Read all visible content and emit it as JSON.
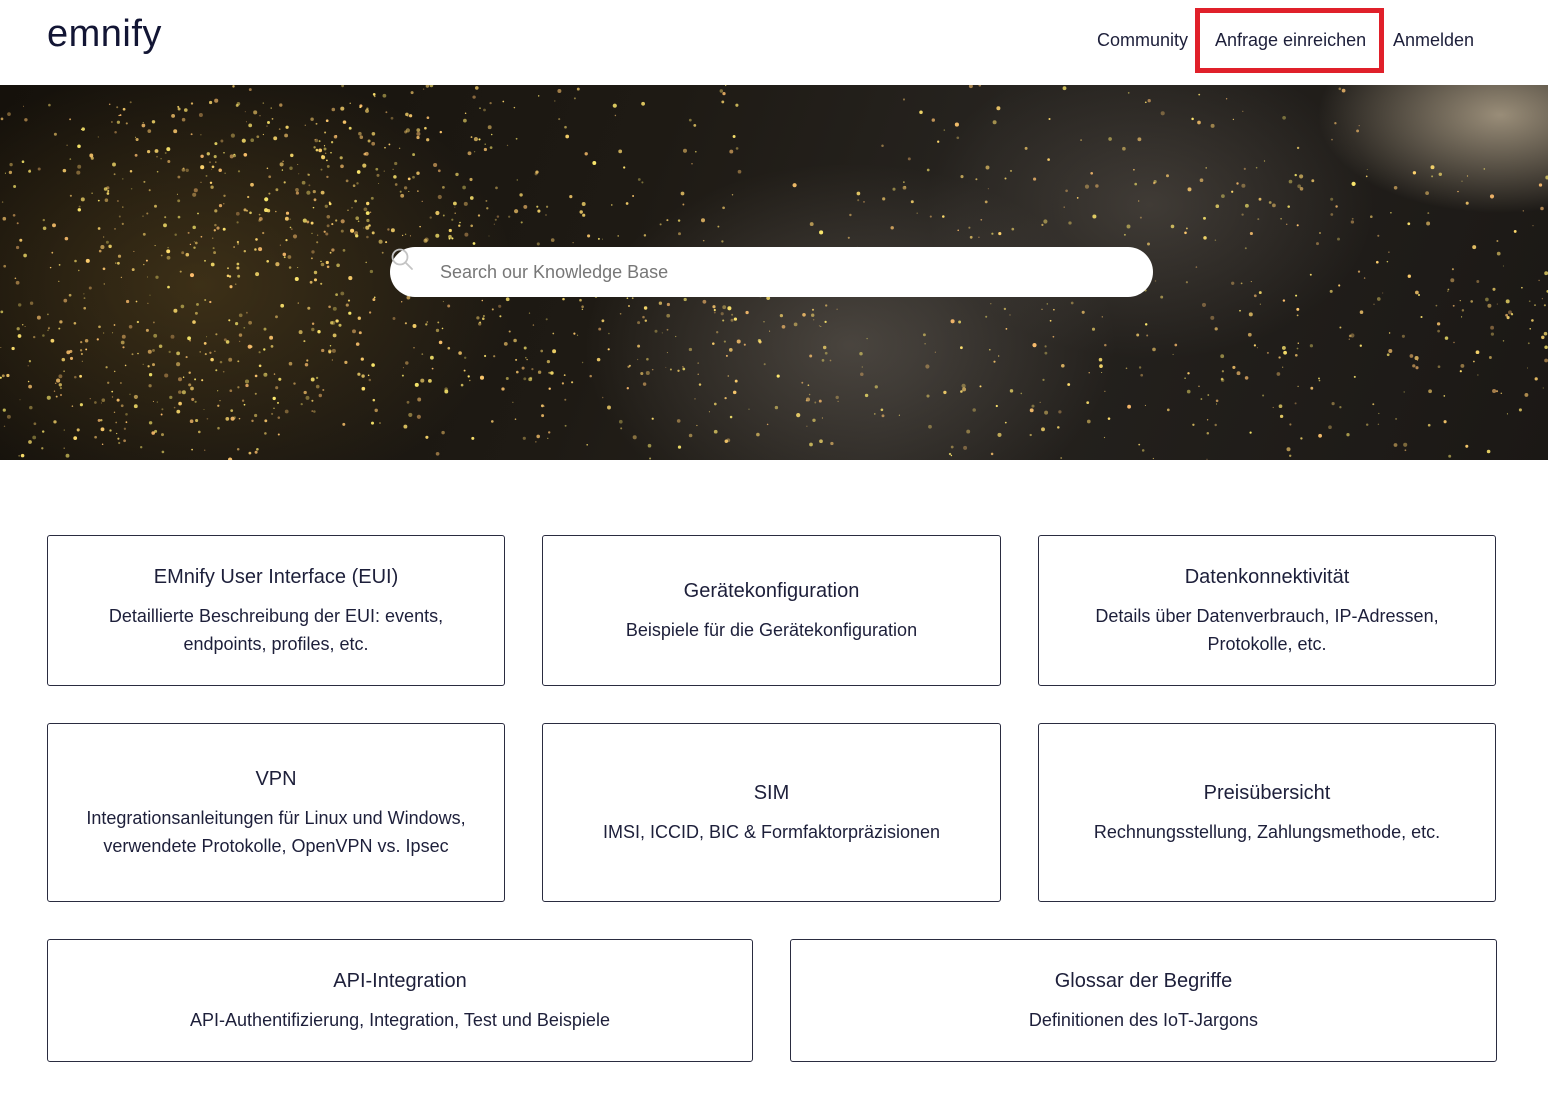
{
  "header": {
    "logo": "emnify",
    "nav": {
      "community": "Community",
      "request": "Anfrage einreichen",
      "login": "Anmelden"
    },
    "highlight_color": "#e0202a"
  },
  "search": {
    "placeholder": "Search our Knowledge Base",
    "icon": "search-icon"
  },
  "categories": [
    {
      "title": "EMnify User Interface (EUI)",
      "description": "Detaillierte Beschreibung der EUI: events, endpoints, profiles, etc."
    },
    {
      "title": "Gerätekonfiguration",
      "description": "Beispiele für die Gerätekonfiguration"
    },
    {
      "title": "Datenkonnektivität",
      "description": "Details über Datenverbrauch, IP-Adressen, Protokolle, etc."
    },
    {
      "title": "VPN",
      "description": "Integrationsanleitungen für Linux und Windows, verwendete Protokolle, OpenVPN vs. Ipsec"
    },
    {
      "title": "SIM",
      "description": "IMSI, ICCID, BIC & Formfaktorpräzisionen"
    },
    {
      "title": "Preisübersicht",
      "description": "Rechnungsstellung, Zahlungsmethode, etc."
    },
    {
      "title": "API-Integration",
      "description": "API-Authentifizierung, Integration, Test und Beispiele"
    },
    {
      "title": "Glossar der Begriffe",
      "description": "Definitionen des IoT-Jargons"
    }
  ],
  "colors": {
    "text": "#1d1f3a",
    "border": "#2a2c40"
  }
}
